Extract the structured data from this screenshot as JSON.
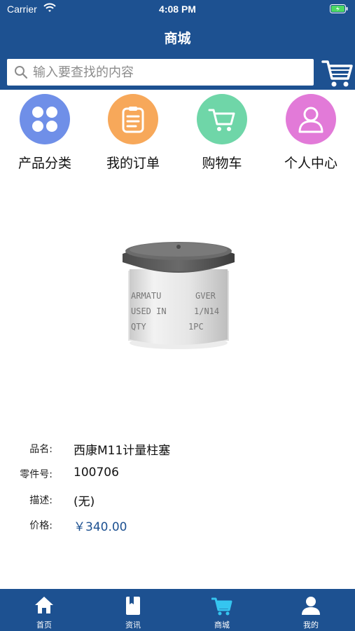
{
  "status_bar": {
    "carrier": "Carrier",
    "time": "4:08 PM"
  },
  "nav": {
    "title": "商城"
  },
  "search": {
    "placeholder": "输入要查找的内容"
  },
  "quick_links": [
    {
      "label": "产品分类",
      "icon": "grid-icon",
      "color": "#6f8fe8"
    },
    {
      "label": "我的订单",
      "icon": "clipboard-icon",
      "color": "#f7a85a"
    },
    {
      "label": "购物车",
      "icon": "cart-icon",
      "color": "#6fd6a8"
    },
    {
      "label": "个人中心",
      "icon": "user-icon",
      "color": "#e27ad8"
    }
  ],
  "product": {
    "image_text": [
      "ARMATU",
      "GVER",
      "USED IN",
      "1/N14",
      "QTY",
      "1PC"
    ],
    "fields": [
      {
        "key": "品名:",
        "value": "西康M11计量柱塞"
      },
      {
        "key": "零件号:",
        "value": "100706"
      },
      {
        "key": "描述:",
        "value": "(无)"
      },
      {
        "key": "价格:",
        "value": "￥340.00"
      }
    ]
  },
  "tabbar": {
    "items": [
      {
        "label": "首页",
        "icon": "home-icon"
      },
      {
        "label": "资讯",
        "icon": "book-icon"
      },
      {
        "label": "商城",
        "icon": "shop-cart-icon",
        "active": true
      },
      {
        "label": "我的",
        "icon": "profile-icon"
      }
    ],
    "active_color": "#35c5f0"
  },
  "colors": {
    "brand": "#1d5191"
  }
}
